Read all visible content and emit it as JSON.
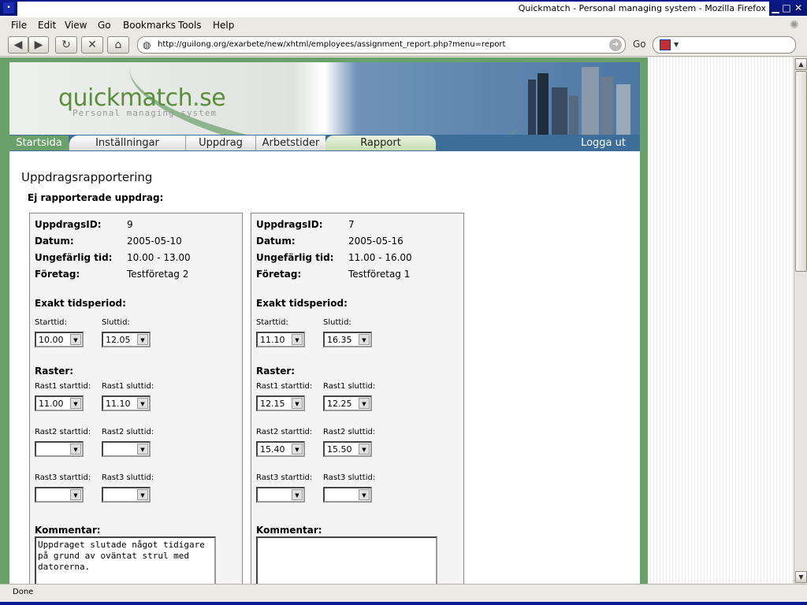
{
  "window": {
    "title": "Quickmatch - Personal managing system - Mozilla Firefox"
  },
  "menubar": {
    "items": [
      "File",
      "Edit",
      "View",
      "Go",
      "Bookmarks",
      "Tools",
      "Help"
    ]
  },
  "navbar": {
    "url": "http://guilong.org/exarbete/new/xhtml/employees/assignment_report.php?menu=report",
    "go_label": "Go"
  },
  "site": {
    "logo": "quickmatch.se",
    "tagline": "Personal managing system",
    "tabs": [
      "Startsida",
      "Inställningar",
      "Uppdrag",
      "Arbetstider",
      "Rapport"
    ],
    "logout": "Logga ut"
  },
  "main": {
    "heading": "Uppdragsrapportering",
    "subheading": "Ej rapporterade uppdrag:",
    "labels": {
      "id": "UppdragsID:",
      "date": "Datum:",
      "approx": "Ungefärlig tid:",
      "company": "Företag:",
      "exact": "Exakt tidsperiod:",
      "start": "Starttid:",
      "end": "Sluttid:",
      "breaks": "Raster:",
      "r1s": "Rast1 starttid:",
      "r1e": "Rast1 sluttid:",
      "r2s": "Rast2 starttid:",
      "r2e": "Rast2 sluttid:",
      "r3s": "Rast3 starttid:",
      "r3e": "Rast3 sluttid:",
      "comment": "Kommentar:"
    },
    "cards": [
      {
        "id": "9",
        "date": "2005-05-10",
        "approx": "10.00 - 13.00",
        "company": "Testföretag 2",
        "start": "10.00",
        "end": "12.05",
        "r1s": "11.00",
        "r1e": "11.10",
        "r2s": "",
        "r2e": "",
        "r3s": "",
        "r3e": "",
        "comment": "Uppdraget slutade något tidigare\npå grund av oväntat strul med\ndatorerna."
      },
      {
        "id": "7",
        "date": "2005-05-16",
        "approx": "11.00 - 16.00",
        "company": "Testföretag 1",
        "start": "11.10",
        "end": "16.35",
        "r1s": "12.15",
        "r1e": "12.25",
        "r2s": "15.40",
        "r2e": "15.50",
        "r3s": "",
        "r3e": "",
        "comment": ""
      }
    ]
  },
  "status": {
    "text": "Done"
  }
}
